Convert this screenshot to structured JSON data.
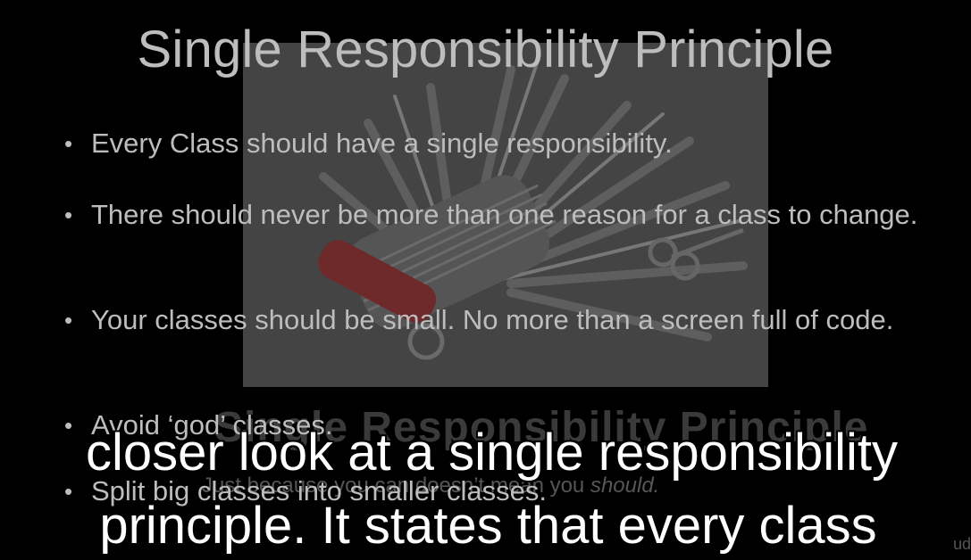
{
  "slide": {
    "title": "Single Responsibility Principle",
    "bullets": [
      "Every Class should have a single responsibility.",
      "There should never be more than one reason for a class to change.",
      "Your classes should be small. No more than a screen full of code.",
      "Avoid ‘god’ classes.",
      "Split big classes into smaller classes."
    ],
    "background_image_icon": "swiss-army-knife-image"
  },
  "previous_slide_ghost": {
    "title": "Single Responsibility Principle",
    "subtitle_prefix": "Just because you can doesn’t mean you ",
    "subtitle_emphasis": "should."
  },
  "caption": {
    "line1": "closer look at a single responsibility",
    "line2": "principle. It states that every class"
  },
  "watermark": "ud",
  "colors": {
    "background": "#000000",
    "slide_text": "#bdbdbd",
    "caption_text": "#ffffff"
  }
}
